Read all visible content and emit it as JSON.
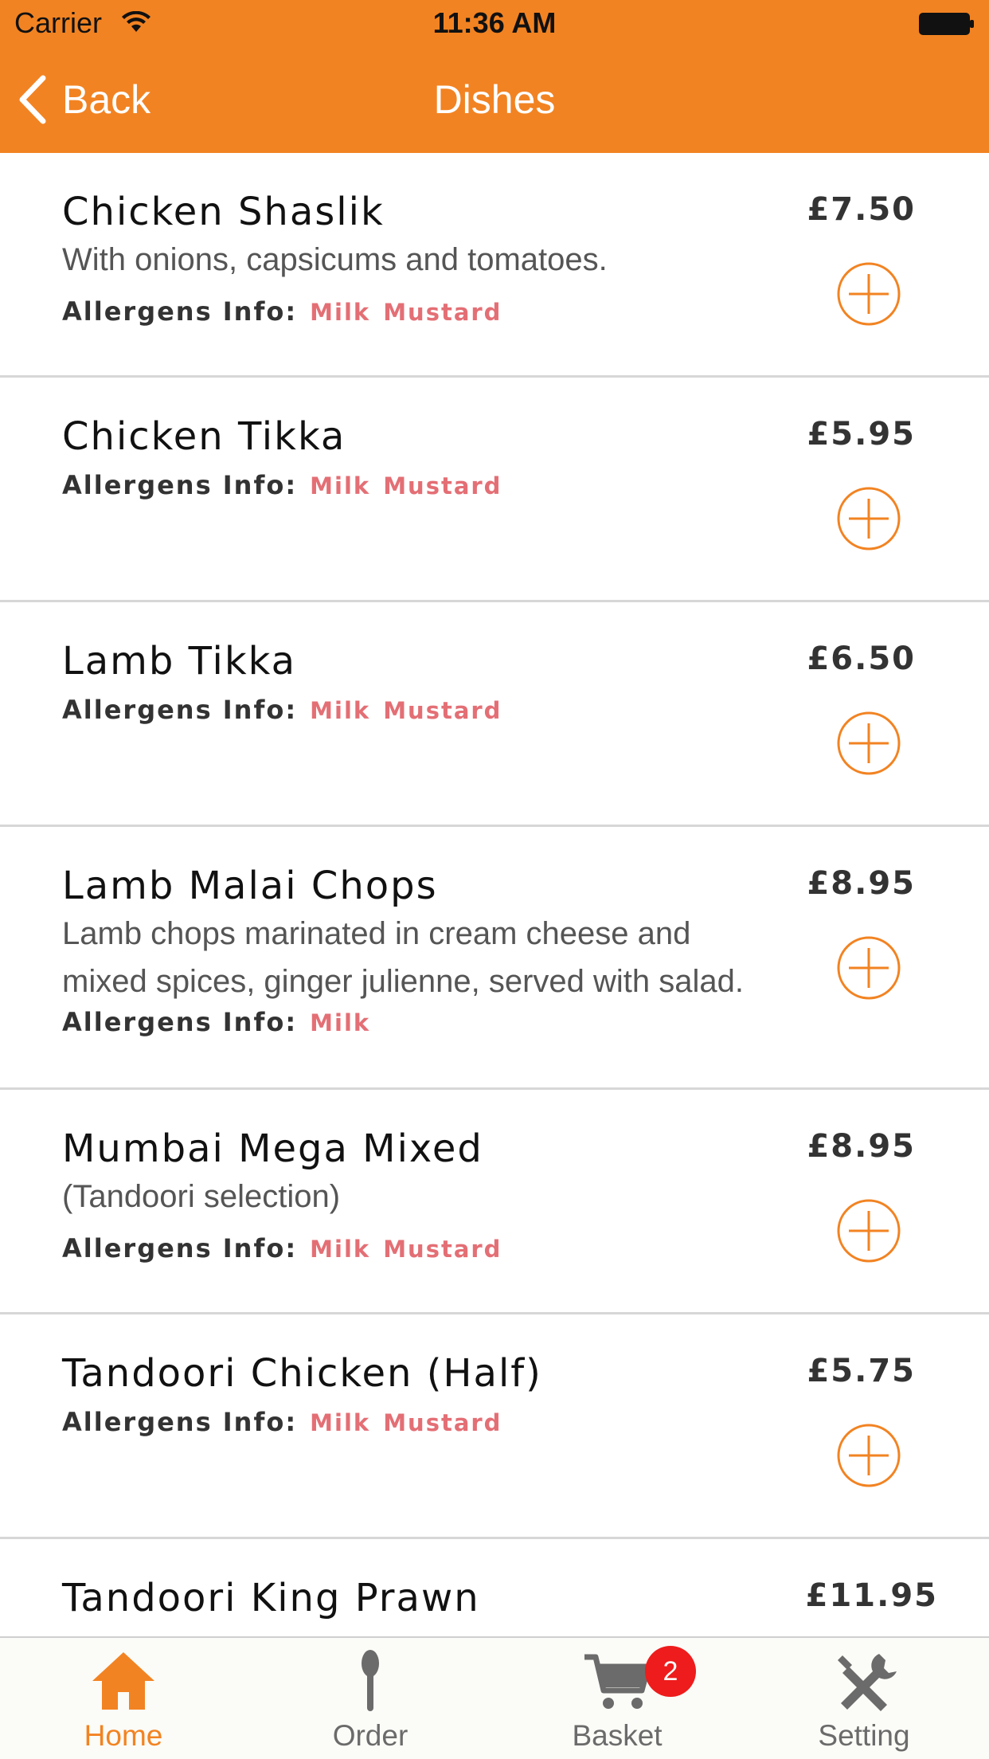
{
  "status_bar": {
    "carrier": "Carrier",
    "time": "11:36 AM",
    "wifi_icon": "wifi-icon",
    "battery_icon": "battery-icon"
  },
  "nav": {
    "back_label": "Back",
    "title": "Dishes",
    "back_icon": "chevron-left-icon"
  },
  "colors": {
    "accent": "#f28322",
    "allergen": "#e36f75",
    "badge": "#ee1c1c"
  },
  "allergen_label": "Allergens Info:",
  "dishes": [
    {
      "name": "Chicken Shaslik",
      "description": "With onions, capsicums and tomatoes.",
      "allergens": [
        "Milk",
        "Mustard"
      ],
      "price": "£7.50"
    },
    {
      "name": "Chicken Tikka",
      "description": "",
      "allergens": [
        "Milk",
        "Mustard"
      ],
      "price": "£5.95"
    },
    {
      "name": "Lamb Tikka",
      "description": "",
      "allergens": [
        "Milk",
        "Mustard"
      ],
      "price": "£6.50"
    },
    {
      "name": "Lamb Malai Chops",
      "description": "Lamb chops marinated in cream cheese and mixed spices, ginger julienne, served with salad.",
      "allergens": [
        "Milk"
      ],
      "price": "£8.95"
    },
    {
      "name": "Mumbai Mega Mixed",
      "description": "(Tandoori selection)",
      "allergens": [
        "Milk",
        "Mustard"
      ],
      "price": "£8.95"
    },
    {
      "name": "Tandoori Chicken (Half)",
      "description": "",
      "allergens": [
        "Milk",
        "Mustard"
      ],
      "price": "£5.75"
    },
    {
      "name": "Tandoori King Prawn",
      "description": "",
      "allergens": [],
      "price": "£11.95"
    }
  ],
  "tabs": [
    {
      "label": "Home",
      "icon": "home-icon",
      "active": true
    },
    {
      "label": "Order",
      "icon": "spoon-icon",
      "active": false
    },
    {
      "label": "Basket",
      "icon": "cart-icon",
      "active": false,
      "badge": "2"
    },
    {
      "label": "Setting",
      "icon": "tools-icon",
      "active": false
    }
  ]
}
